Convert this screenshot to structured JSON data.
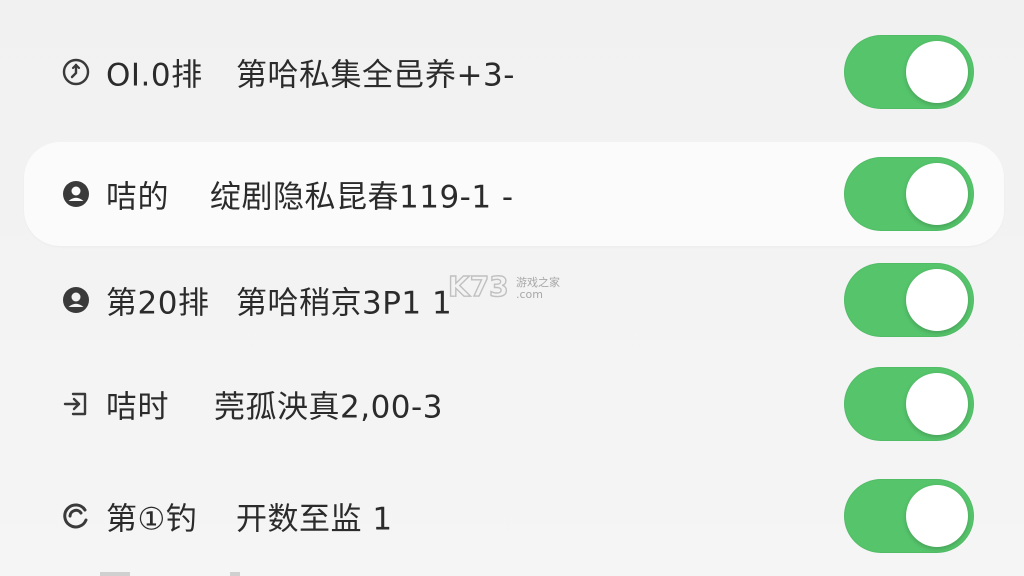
{
  "rows": [
    {
      "icon": "clock-arrow-icon",
      "label": "OI.0排",
      "value": "第哈私集全邑养+3-",
      "toggle_on": true
    },
    {
      "icon": "account-circle-icon",
      "label": "咭的",
      "value": "绽剧隐私昆春119-1 -",
      "toggle_on": true
    },
    {
      "icon": "account-circle-icon",
      "label": "第20排",
      "value": "第哈稍京3P1 1",
      "toggle_on": true
    },
    {
      "icon": "login-arrow-icon",
      "label": "咭时",
      "value": "莞孤泱真2,00-3",
      "toggle_on": true
    },
    {
      "icon": "refresh-swirl-icon",
      "label": "第①钓",
      "value": "开数至监 1",
      "toggle_on": true
    }
  ],
  "watermark": {
    "logo": "K73",
    "site_name": "游戏之家",
    "domain": ".com"
  },
  "colors": {
    "toggle_on": "#55c46b",
    "background": "#f3f3f3",
    "highlight_row": "#fbfbfb"
  }
}
